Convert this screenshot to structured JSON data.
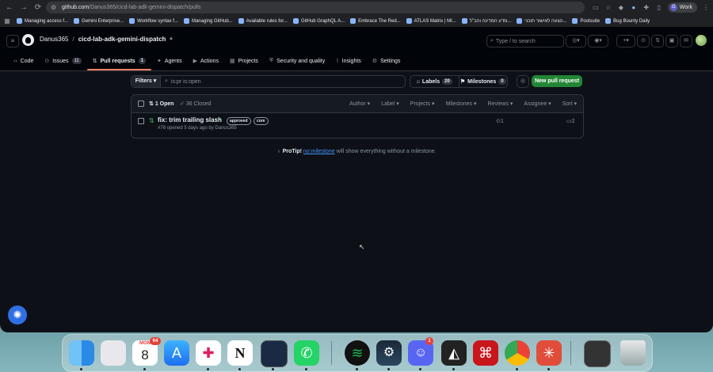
{
  "browser": {
    "url_host": "github.com",
    "url_path": "/Danus365/cicd-lab-adk-gemini-dispatch/pulls",
    "profile": "Work",
    "bookmarks": [
      "Managing access f...",
      "Gemini Enterprise...",
      "Workflow syntax f...",
      "Managing GitHub...",
      "Available rules for...",
      "GitHub GraphQL A...",
      "Embrace The Red...",
      "ATLAS Matrix | MI...",
      "מדע המדינה והב\"ל...",
      "הצעה לאישור תוכני...",
      "Poolsuite",
      "Bug Bounty Daily"
    ]
  },
  "header": {
    "owner": "Danus365",
    "separator": "/",
    "repo": "cicd-lab-adk-gemini-dispatch",
    "search_placeholder": "Type / to search",
    "search_kbd": "/"
  },
  "tabs": [
    {
      "label": "Code",
      "icon": "code-icon"
    },
    {
      "label": "Issues",
      "icon": "issue-icon",
      "count": "11"
    },
    {
      "label": "Pull requests",
      "icon": "pull-request-icon",
      "count": "1",
      "active": true
    },
    {
      "label": "Agents",
      "icon": "agents-icon"
    },
    {
      "label": "Actions",
      "icon": "play-icon"
    },
    {
      "label": "Projects",
      "icon": "table-icon"
    },
    {
      "label": "Security and quality",
      "icon": "shield-icon"
    },
    {
      "label": "Insights",
      "icon": "graph-icon"
    },
    {
      "label": "Settings",
      "icon": "gear-icon"
    }
  ],
  "filters": {
    "button": "Filters",
    "query": "is:pr is:open",
    "labels_label": "Labels",
    "labels_count": "20",
    "milestones_label": "Milestones",
    "milestones_count": "0",
    "new_pr": "New pull request"
  },
  "list_header": {
    "open": "1 Open",
    "closed": "36 Closed",
    "menus": [
      "Author",
      "Label",
      "Projects",
      "Milestones",
      "Reviews",
      "Assignee",
      "Sort"
    ]
  },
  "pull_requests": [
    {
      "title": "fix: trim trailing slash",
      "labels": [
        "approved",
        "core"
      ],
      "meta": "#78 opened 5 days ago by Danus365",
      "checks": "1",
      "comments": "2"
    }
  ],
  "protip": {
    "prefix": "ProTip!",
    "link": "no:milestone",
    "suffix": "will show everything without a milestone."
  },
  "dock": {
    "calendar_month": "MON",
    "calendar_day": "8",
    "calendar_badge": "64",
    "discord_badge": "1"
  },
  "colors": {
    "accent_green": "#238636",
    "underline": "#f78166",
    "link": "#4493f8"
  }
}
